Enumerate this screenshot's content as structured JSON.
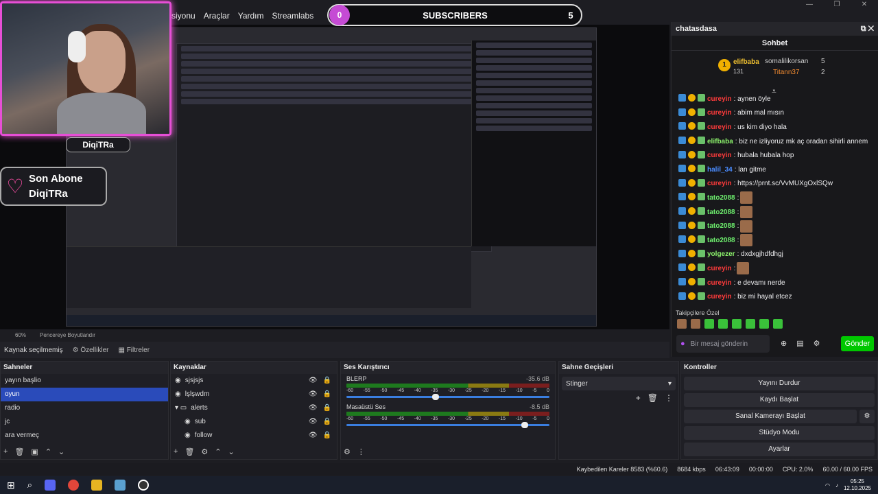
{
  "menu": [
    "siyonu",
    "Araçlar",
    "Yardım",
    "Streamlabs"
  ],
  "window_controls": [
    "—",
    "❐",
    "✕"
  ],
  "overlay": {
    "subscribers_label": "SUBSCRIBERS",
    "subscribers_current": "0",
    "subscribers_goal": "5",
    "name_tag": "DiqiTRa",
    "last_sub_title": "Son Abone",
    "last_sub_name": "DiqiTRa"
  },
  "chat": {
    "window_title": "chatasdasa",
    "panel_title": "Sohbet",
    "leaderboard": {
      "first": {
        "name": "elifbaba",
        "count": "131"
      },
      "second": {
        "name": "somalilikorsan",
        "count": "5"
      },
      "third": {
        "name": "Titann37",
        "count": "2"
      }
    },
    "messages": [
      {
        "user": "cureyin",
        "color": "#ff3b3b",
        "text": ": aynen öyle"
      },
      {
        "user": "cureyin",
        "color": "#ff3b3b",
        "text": ": abim mal mısın"
      },
      {
        "user": "cureyin",
        "color": "#ff3b3b",
        "text": ": us kim diyo hala"
      },
      {
        "user": "elifbaba",
        "color": "#8cf26c",
        "text": ": biz ne izliyoruz mk aç oradan sihirli annem"
      },
      {
        "user": "cureyin",
        "color": "#ff3b3b",
        "text": ": hubala hubala hop"
      },
      {
        "user": "halil_34",
        "color": "#4a8cff",
        "text": ": lan gitme"
      },
      {
        "user": "cureyin",
        "color": "#ff3b3b",
        "text": ": https://prnt.sc/VvMUXgOxlSQw"
      },
      {
        "user": "tato2088",
        "color": "#6ef06e",
        "text": ":"
      },
      {
        "user": "tato2088",
        "color": "#6ef06e",
        "text": ":"
      },
      {
        "user": "tato2088",
        "color": "#6ef06e",
        "text": ":"
      },
      {
        "user": "tato2088",
        "color": "#6ef06e",
        "text": ":"
      },
      {
        "user": "yolgezer",
        "color": "#8cf26c",
        "text": ": dxdxgjhdfdhgj"
      },
      {
        "user": "cureyin",
        "color": "#ff3b3b",
        "text": ":"
      },
      {
        "user": "cureyin",
        "color": "#ff3b3b",
        "text": ": e devamı nerde"
      },
      {
        "user": "cureyin",
        "color": "#ff3b3b",
        "text": ": biz mi hayal etcez"
      }
    ],
    "followers_only_label": "Takipçilere Özel",
    "input_placeholder": "Bir mesaj gönderin",
    "send_label": "Gönder"
  },
  "obs": {
    "zoom": "60%",
    "fit_label": "Pencereye Boyutlandır",
    "no_source": "Kaynak seçilmemiş",
    "properties_label": "Özellikler",
    "filters_label": "Filtreler",
    "scenes_title": "Sahneler",
    "scenes": [
      "yayın başlio",
      "oyun",
      "radio",
      "jc",
      "ara vermeç"
    ],
    "selected_scene_index": 1,
    "sources_title": "Kaynaklar",
    "sources": [
      "sjsjsjs",
      "lşlşwdm",
      "alerts",
      "sub",
      "follow"
    ],
    "mixer_title": "Ses Karıştırıcı",
    "mixer": [
      {
        "name": "BLERP",
        "db": "-35.6 dB",
        "volume_fraction": 0.44
      },
      {
        "name": "Masaüstü Ses",
        "db": "-8.5 dB",
        "volume_fraction": 0.88
      }
    ],
    "meter_scale": [
      "-60",
      "-55",
      "-50",
      "-45",
      "-40",
      "-35",
      "-30",
      "-25",
      "-20",
      "-15",
      "-10",
      "-5",
      "0"
    ],
    "transitions_title": "Sahne Geçişleri",
    "transition_value": "Stinger",
    "controls_title": "Kontroller",
    "controls": [
      "Yayını Durdur",
      "Kaydı Başlat",
      "Sanal Kamerayı Başlat",
      "Stüdyo Modu",
      "Ayarlar"
    ]
  },
  "status": {
    "dropped": "Kaybedilen Kareler 8583 (%60.6)",
    "bitrate": "8684 kbps",
    "stream_time": "06:43:09",
    "rec_time": "00:00:00",
    "cpu": "CPU: 2.0%",
    "fps": "60.00 / 60.00 FPS"
  },
  "taskbar": {
    "time": "05:25",
    "date": "12.10.2025"
  }
}
